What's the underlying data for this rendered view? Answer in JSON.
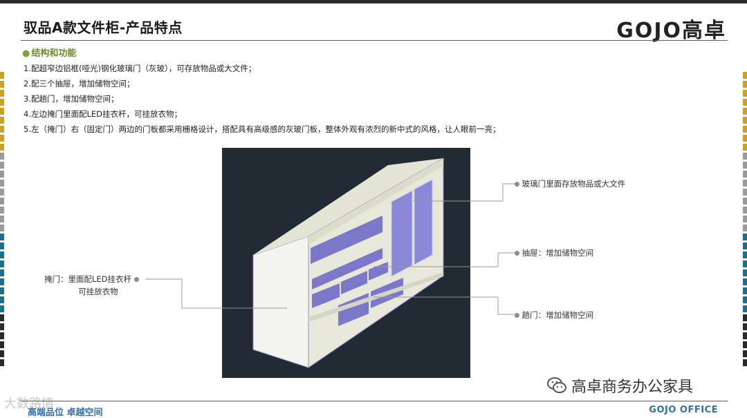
{
  "header": {
    "title": "驭品A款文件柜-产品特点",
    "logo_text": "GOJO高卓"
  },
  "section": {
    "heading": "结构和功能",
    "items": [
      "1.配超窄边铝框(哑光)钢化玻璃门（灰玻），可存放物品或大文件；",
      "2.配三个抽屉，增加储物空间；",
      "3.配趟门，增加储物空间；",
      "4.左边掩门里面配LED挂衣杆，可挂放衣物；",
      "5.左（掩门）右（固定门）两边的门板都采用栅格设计，搭配具有高级感的灰玻门板，整体外观有浓烈的新中式的风格，让人眼前一亮；"
    ]
  },
  "callouts": {
    "glass_door": "玻璃门里面存放物品或大文件",
    "drawer": "抽屉：增加储物空间",
    "sliding_door": "趟门：增加储物空间",
    "hinged_door_line1": "掩门：里面配LED挂衣杆",
    "hinged_door_line2": "可挂放衣物"
  },
  "footer": {
    "slogan": "高端品位 卓越空间",
    "brand": "GOJO OFFICE"
  },
  "wechat": {
    "account": "高卓商务办公家具"
  },
  "watermark": {
    "text": "大数路情"
  },
  "colors": {
    "section_green": "#6a8a2b",
    "footer_blue": "#2f6fb0",
    "photo_bg": "#222b33",
    "cabinet_body": "#e8e8d8",
    "cabinet_panel": "#7b78c9"
  },
  "side_bar_colors": [
    "#c9a227",
    "#9a9a9a",
    "#1f6f8b",
    "#2a2a2a"
  ]
}
